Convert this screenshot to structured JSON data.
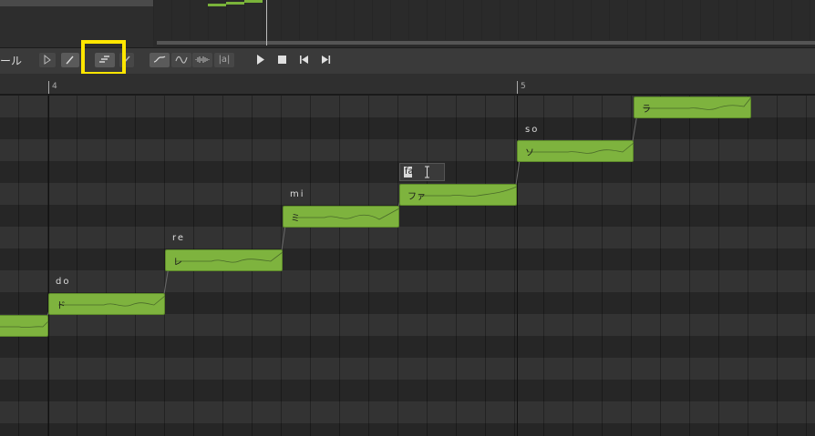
{
  "toolbar": {
    "title_fragment": "ール",
    "buttons": [
      {
        "name": "pointer-tool-button",
        "icon": "pointer-icon"
      },
      {
        "name": "pencil-tool-button",
        "icon": "pencil-icon"
      },
      {
        "name": "note-line-tool-button",
        "icon": "note-line-icon"
      },
      {
        "name": "brush-tool-button",
        "icon": "brush-icon"
      },
      {
        "name": "pitch-curve-button",
        "icon": "pitch-curve-icon"
      },
      {
        "name": "vibrato-button",
        "icon": "vibrato-icon"
      },
      {
        "name": "waveform-button",
        "icon": "waveform-icon"
      },
      {
        "name": "phoneme-button",
        "label": "|a|"
      },
      {
        "name": "play-button",
        "icon": "play-icon"
      },
      {
        "name": "stop-button",
        "icon": "stop-icon"
      },
      {
        "name": "rewind-button",
        "icon": "skip-back-icon"
      },
      {
        "name": "forward-button",
        "icon": "skip-forward-icon"
      }
    ],
    "phoneme_label": "|a|"
  },
  "ruler": {
    "bars": [
      "4",
      "5"
    ]
  },
  "notes": [
    {
      "kana": "",
      "lyric": ""
    },
    {
      "kana": "ド",
      "lyric": "do"
    },
    {
      "kana": "レ",
      "lyric": "re"
    },
    {
      "kana": "ミ",
      "lyric": "mi"
    },
    {
      "kana": "ファ",
      "lyric": ""
    },
    {
      "kana": "ソ",
      "lyric": "so"
    },
    {
      "kana": "ラ",
      "lyric": ""
    }
  ],
  "lyric_editor": {
    "value": "fa"
  },
  "colors": {
    "note": "#7eb33e",
    "highlight": "#ffe600",
    "background": "#2b2b2b"
  }
}
